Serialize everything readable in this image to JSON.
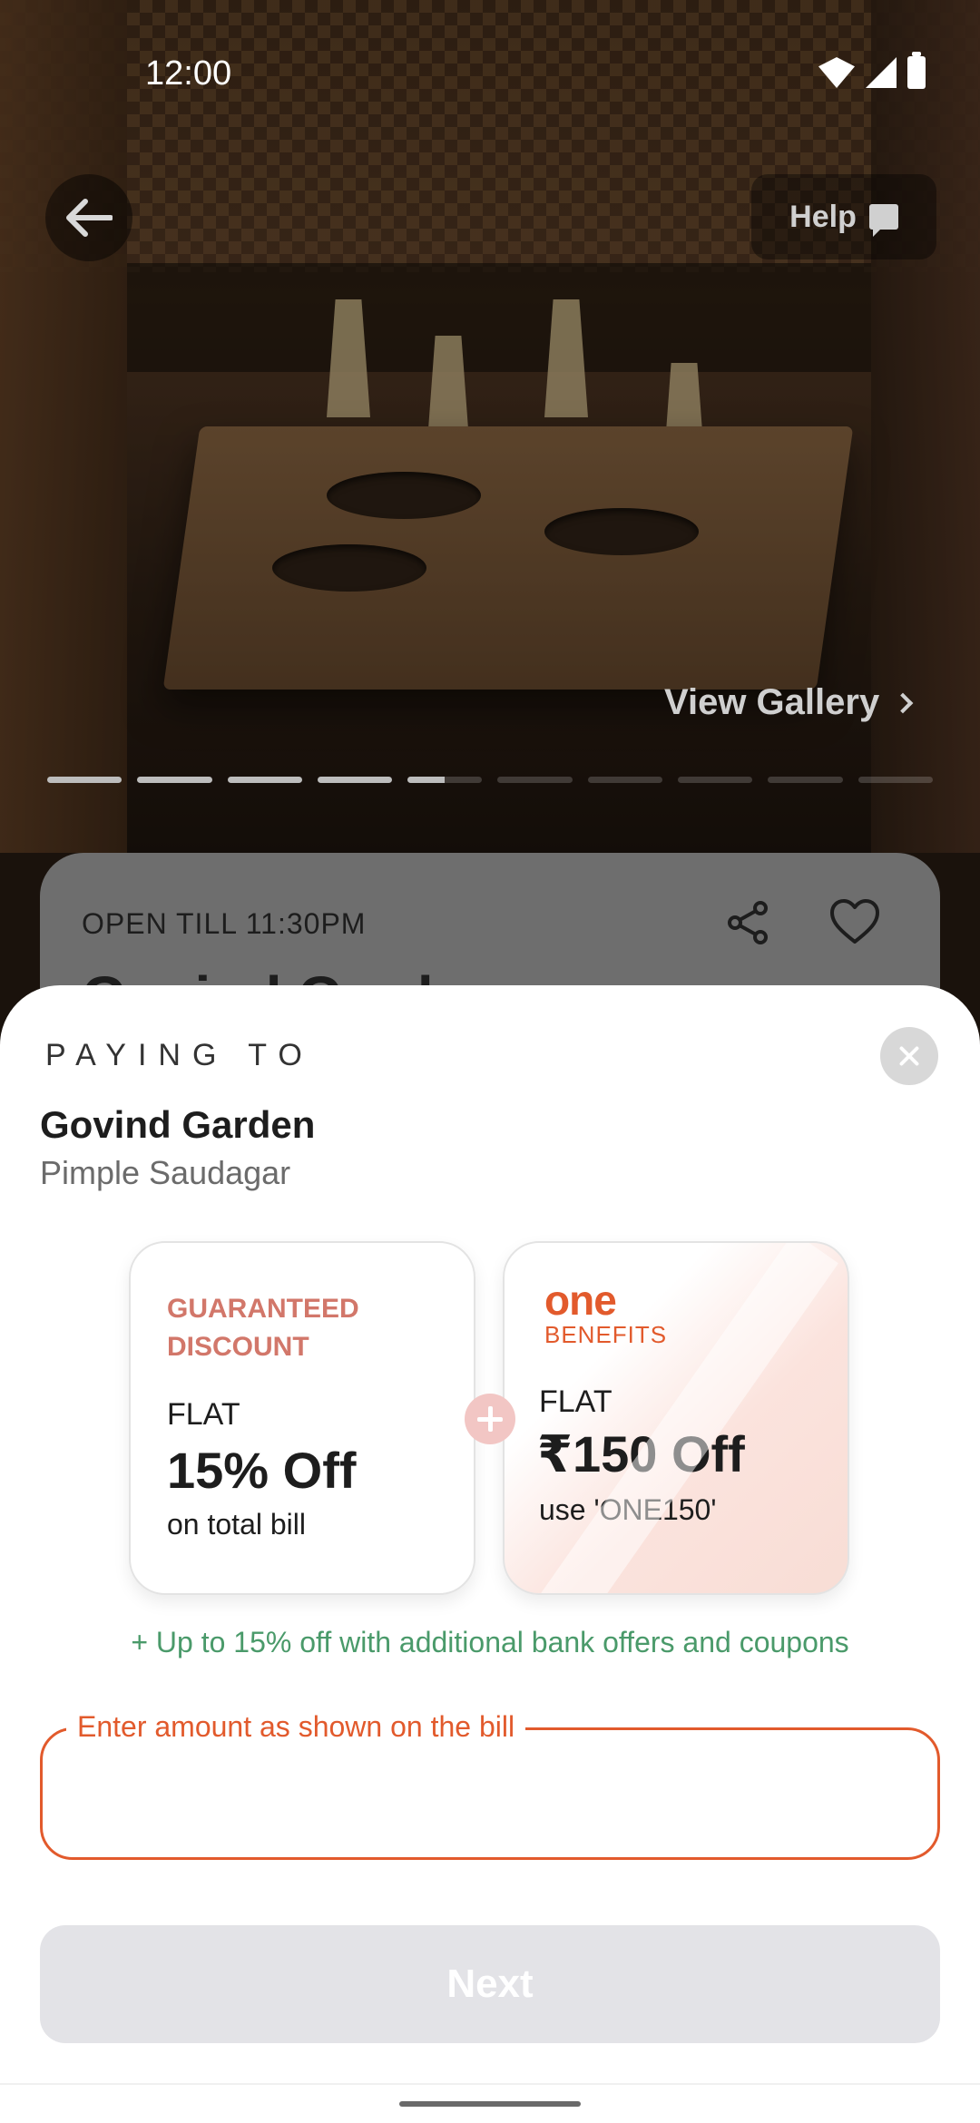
{
  "status_bar": {
    "time": "12:00"
  },
  "header": {
    "help_label": "Help"
  },
  "gallery": {
    "view_label": "View Gallery",
    "progress": [
      1,
      1,
      1,
      1,
      0.5,
      0,
      0,
      0,
      0,
      0
    ]
  },
  "restaurant_card": {
    "open_till": "OPEN TILL 11:30PM",
    "name_peek": "Govind Garden"
  },
  "payment_sheet": {
    "paying_to_label": "PAYING TO",
    "merchant_name": "Govind Garden",
    "merchant_area": "Pimple Saudagar",
    "offer_guaranteed": {
      "label": "GUARANTEED DISCOUNT",
      "flat": "FLAT",
      "amount": "15% Off",
      "detail": "on total bill"
    },
    "offer_one": {
      "logo_text": "one",
      "logo_sub": "BENEFITS",
      "flat": "FLAT",
      "amount": "₹150 Off",
      "detail": "use 'ONE150'"
    },
    "bank_note": "+ Up to 15% off with additional bank offers and coupons",
    "amount_label": "Enter amount as shown on the bill",
    "amount_value": "",
    "next_label": "Next"
  },
  "colors": {
    "accent": "#e25a2c",
    "discount_label": "#d2776a",
    "bank_note": "#4a9a6a",
    "next_disabled": "#e3e3e7"
  }
}
